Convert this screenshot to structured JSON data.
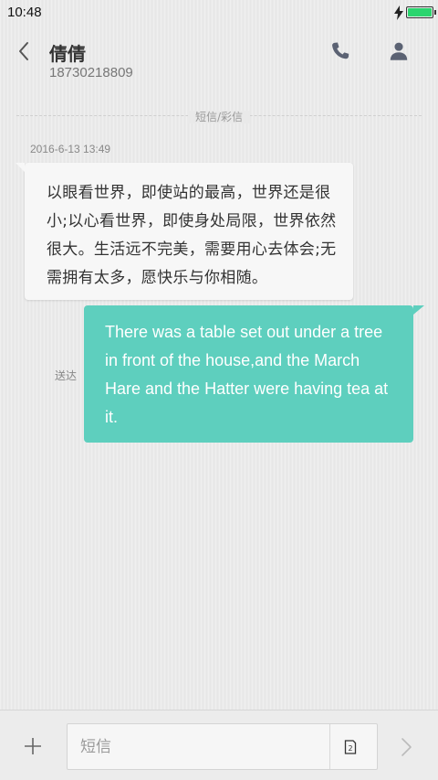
{
  "status_bar": {
    "time": "10:48"
  },
  "header": {
    "contact_name": "倩倩",
    "contact_number": "18730218809"
  },
  "conversation": {
    "type_label": "短信/彩信",
    "timestamp": "2016-6-13 13:49",
    "incoming_message": "以眼看世界，即使站的最高，世界还是很小;以心看世界，即使身处局限，世界依然很大。生活远不完美，需要用心去体会;无需拥有太多，愿快乐与你相随。",
    "outgoing_message": "There was a table set out under a tree in front of the house,and the March Hare and the Hatter were having tea at it.",
    "delivery_status": "送达"
  },
  "composer": {
    "placeholder": "短信",
    "value": ""
  },
  "colors": {
    "outgoing_bubble": "#5ecfbe",
    "incoming_bubble": "#f7f7f7",
    "battery": "#2ad56e"
  }
}
